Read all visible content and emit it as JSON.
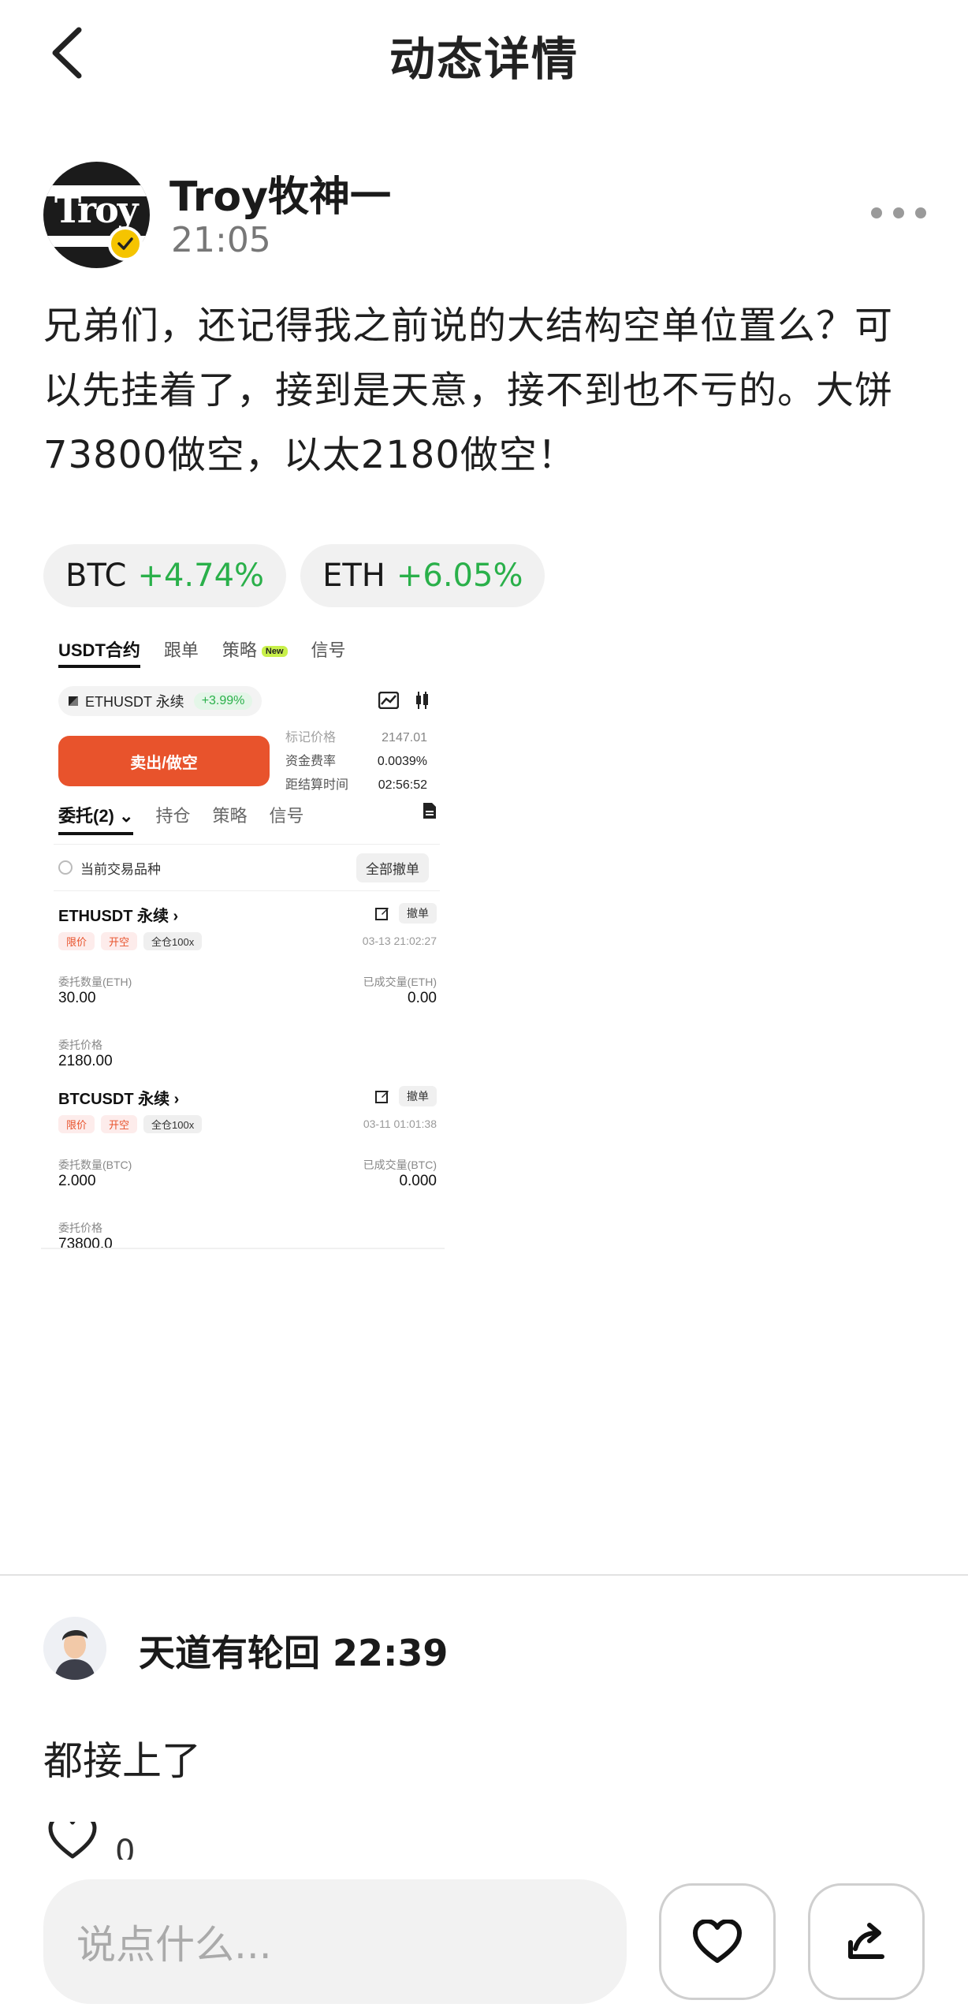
{
  "header": {
    "title": "动态详情"
  },
  "post": {
    "author": "Troy牧神一",
    "avatar_text": "Troy",
    "time": "21:05",
    "text": "兄弟们，还记得我之前说的大结构空单位置么？可以先挂着了，接到是天意，接不到也不亏的。大饼73800做空，以太2180做空！",
    "coins": [
      {
        "symbol": "BTC",
        "change": "+4.74%"
      },
      {
        "symbol": "ETH",
        "change": "+6.05%"
      }
    ]
  },
  "screenshot": {
    "tabs": [
      "USDT合约",
      "跟单",
      "策略",
      "信号"
    ],
    "new_badge": "New",
    "pair": "ETHUSDT 永续",
    "pair_change": "+3.99%",
    "sell_button": "卖出/做空",
    "info": [
      {
        "label": "标记价格",
        "value": "2147.01"
      },
      {
        "label": "资金费率",
        "value": "0.0039%"
      },
      {
        "label": "距结算时间",
        "value": "02:56:52"
      }
    ],
    "order_tabs": [
      "委托(2)",
      "持仓",
      "策略",
      "信号"
    ],
    "filter_label": "当前交易品种",
    "cancel_all": "全部撤单",
    "orders": [
      {
        "pair": "ETHUSDT 永续",
        "tags": [
          "限价",
          "开空",
          "全仓100x"
        ],
        "cancel": "撤单",
        "date": "03-13 21:02:27",
        "qty_label": "委托数量(ETH)",
        "qty": "30.00",
        "filled_label": "已成交量(ETH)",
        "filled": "0.00",
        "price_label": "委托价格",
        "price": "2180.00"
      },
      {
        "pair": "BTCUSDT 永续",
        "tags": [
          "限价",
          "开空",
          "全仓100x"
        ],
        "cancel": "撤单",
        "date": "03-11 01:01:38",
        "qty_label": "委托数量(BTC)",
        "qty": "2.000",
        "filled_label": "已成交量(BTC)",
        "filled": "0.000",
        "price_label": "委托价格",
        "price": "73800.0"
      }
    ]
  },
  "comment": {
    "author": "天道有轮回",
    "time": "22:39",
    "text": "都接上了",
    "likes": "0"
  },
  "bottom_bar": {
    "placeholder": "说点什么..."
  },
  "colors": {
    "positive": "#2ab04a",
    "sell": "#e8532c",
    "verified": "#f5c400"
  }
}
